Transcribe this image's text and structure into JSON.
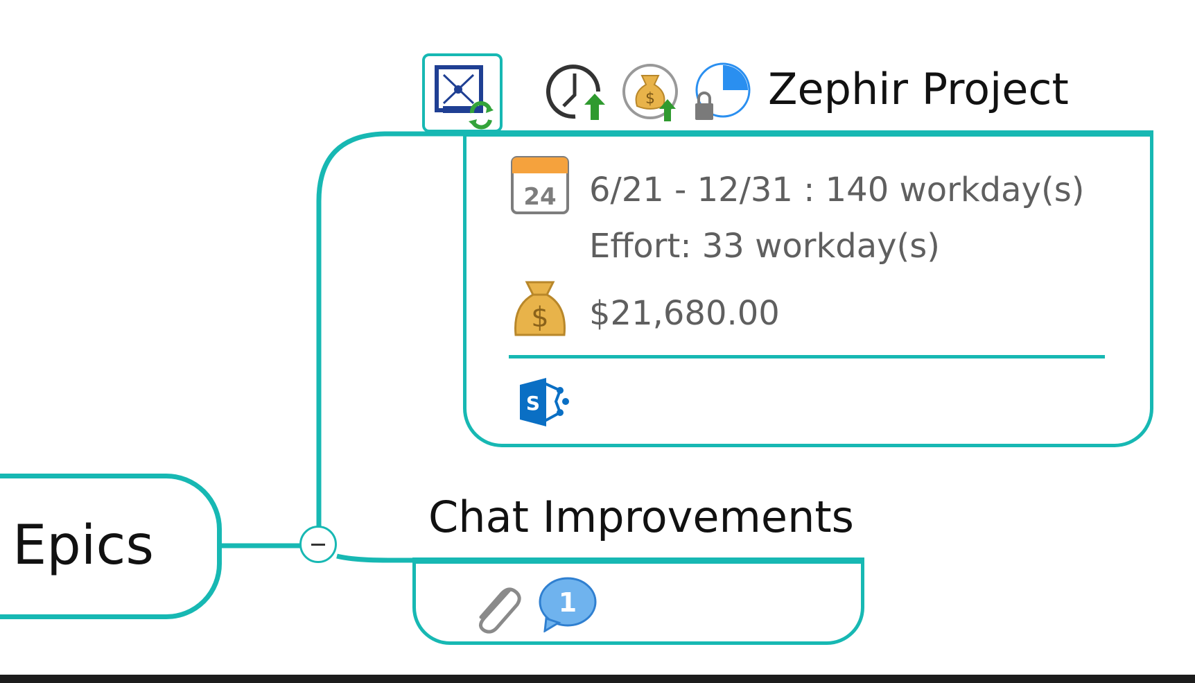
{
  "colors": {
    "accent": "#17b8b3",
    "text_dark": "#111111",
    "text_muted": "#5f5f5f",
    "money_gold": "#e8b34a",
    "calendar_orange": "#f5a23d",
    "progress_blue": "#2a8ff0",
    "sharepoint_blue": "#0a6fc4",
    "comment_blue": "#4a9be6"
  },
  "root_topic": {
    "label": "Epics"
  },
  "topics": [
    {
      "title": "Zephir Project",
      "icons": [
        "task-sync-icon",
        "schedule-up-icon",
        "cost-up-icon",
        "lock-progress-icon"
      ],
      "progress_fraction": 0.25,
      "details": {
        "date_range": "6/21 - 12/31 : 140 workday(s)",
        "effort": "Effort: 33 workday(s)",
        "cost": "$21,680.00",
        "calendar_day": "24",
        "footer_icon": "sharepoint-icon"
      }
    },
    {
      "title": "Chat Improvements",
      "attachments_icon": "paperclip-icon",
      "comment_count": "1"
    }
  ]
}
